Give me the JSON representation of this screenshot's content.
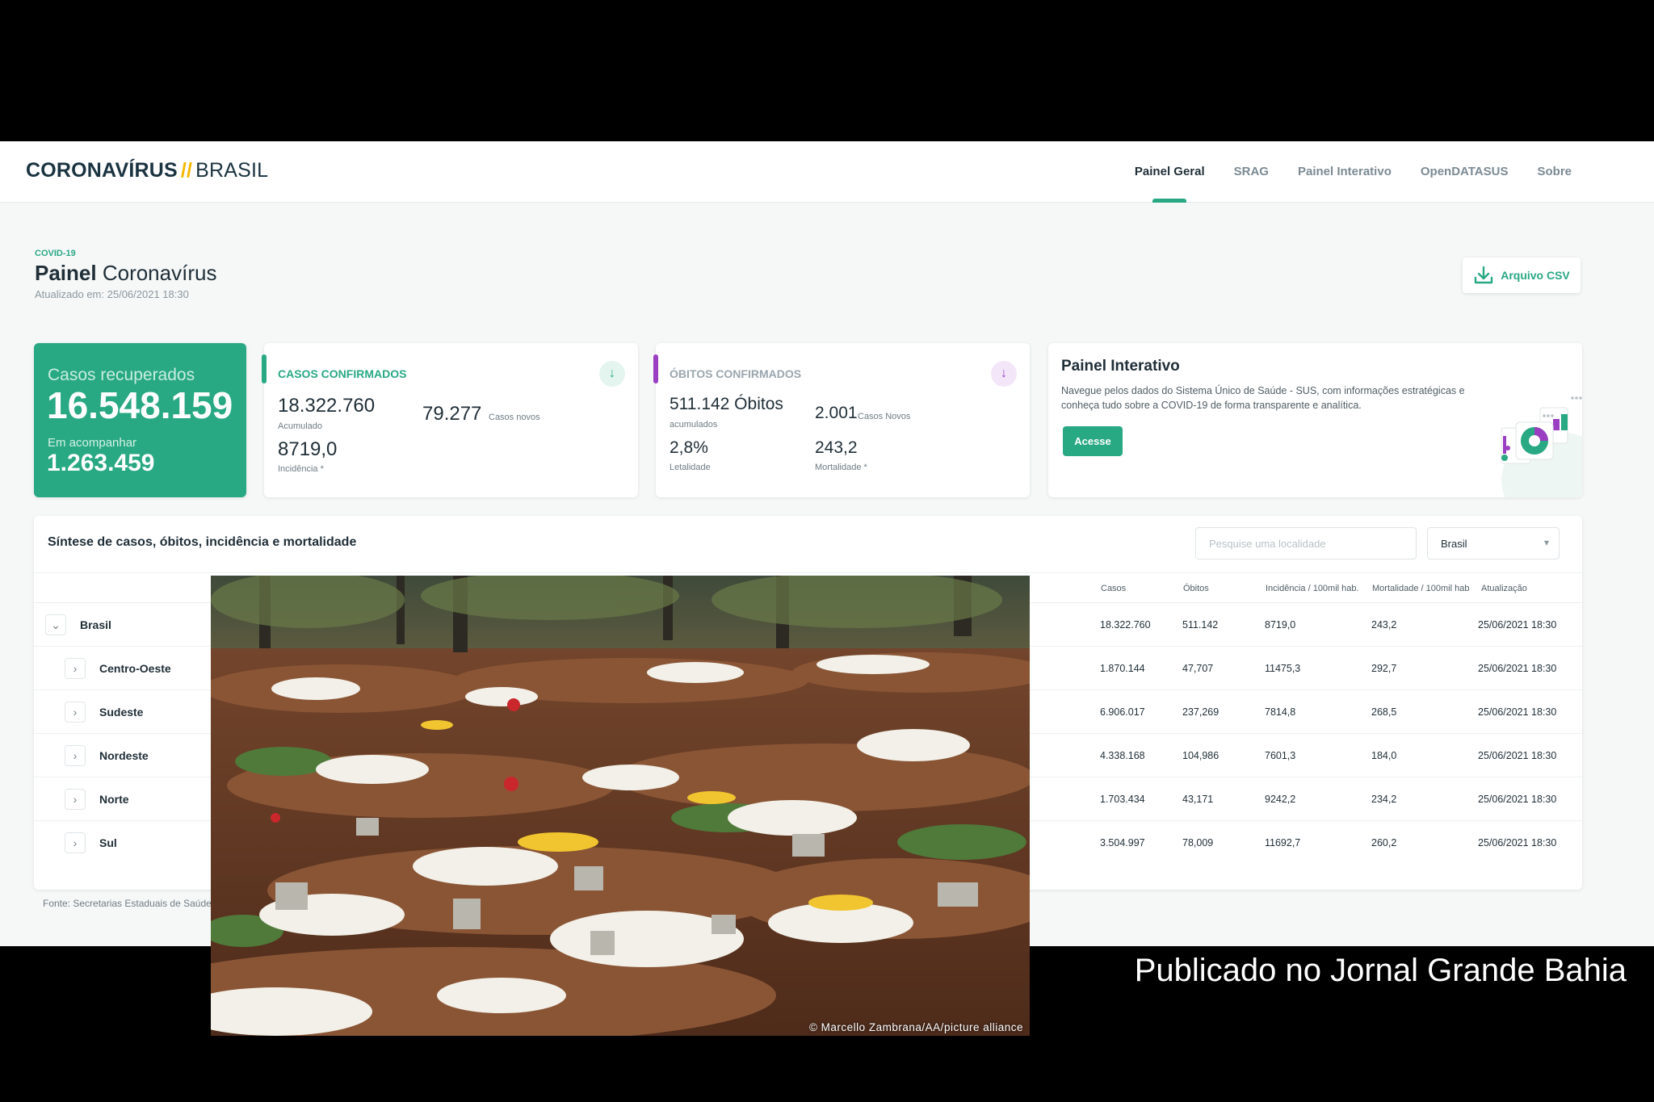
{
  "header": {
    "brand_bold": "CORONAVÍRUS",
    "brand_sep": "//",
    "brand_light": "BRASIL",
    "nav": [
      "Painel Geral",
      "SRAG",
      "Painel Interativo",
      "OpenDATASUS",
      "Sobre"
    ],
    "active_nav": "Painel Geral"
  },
  "title": {
    "tag": "COVID-19",
    "bold": "Painel",
    "light": "Coronavírus",
    "updated_label": "Atualizado em:",
    "updated_value": "25/06/2021 18:30",
    "csv_button": "Arquivo CSV"
  },
  "recovered": {
    "label": "Casos recuperados",
    "value": "16.548.159",
    "follow_label": "Em acompanhar",
    "follow_value": "1.263.459"
  },
  "confirmed": {
    "title": "CASOS CONFIRMADOS",
    "accumulated": "18.322.760",
    "accumulated_label": "Acumulado",
    "new": "79.277",
    "new_label": "Casos novos",
    "incidence": "8719,0",
    "incidence_label": "Incidência *"
  },
  "deaths": {
    "title": "ÓBITOS CONFIRMADOS",
    "accumulated": "511.142 Óbitos",
    "accumulated_label": "acumulados",
    "new": "2.001",
    "new_label": "Casos Novos",
    "lethality": "2,8%",
    "lethality_label": "Letalidade",
    "mortality": "243,2",
    "mortality_label": "Mortalidade *"
  },
  "panel": {
    "title": "Painel Interativo",
    "text": "Navegue pelos dados do Sistema Único de Saúde - SUS, com informações estratégicas e conheça tudo sobre a COVID-19 de forma transparente e analítica.",
    "button": "Acesse"
  },
  "table": {
    "title": "Síntese de casos, óbitos, incidência e mortalidade",
    "search_placeholder": "Pesquise uma localidade",
    "select_value": "Brasil",
    "headers": [
      "Casos",
      "Óbitos",
      "Incidência / 100mil hab.",
      "Mortalidade / 100mil hab",
      "Atualização"
    ],
    "rows": [
      {
        "name": "Brasil",
        "casos": "18.322.760",
        "obitos": "511.142",
        "incidencia": "8719,0",
        "mortalidade": "243,2",
        "atualizacao": "25/06/2021 18:30"
      },
      {
        "name": "Centro-Oeste",
        "casos": "1.870.144",
        "obitos": "47,707",
        "incidencia": "11475,3",
        "mortalidade": "292,7",
        "atualizacao": "25/06/2021 18:30"
      },
      {
        "name": "Sudeste",
        "casos": "6.906.017",
        "obitos": "237,269",
        "incidencia": "7814,8",
        "mortalidade": "268,5",
        "atualizacao": "25/06/2021 18:30"
      },
      {
        "name": "Nordeste",
        "casos": "4.338.168",
        "obitos": "104,986",
        "incidencia": "7601,3",
        "mortalidade": "184,0",
        "atualizacao": "25/06/2021 18:30"
      },
      {
        "name": "Norte",
        "casos": "1.703.434",
        "obitos": "43,171",
        "incidencia": "9242,2",
        "mortalidade": "234,2",
        "atualizacao": "25/06/2021 18:30"
      },
      {
        "name": "Sul",
        "casos": "3.504.997",
        "obitos": "78,009",
        "incidencia": "11692,7",
        "mortalidade": "260,2",
        "atualizacao": "25/06/2021 18:30"
      }
    ],
    "source": "Fonte: Secretarias Estaduais de Saúde"
  },
  "photo": {
    "credit": "© Marcello Zambrana/AA/picture alliance"
  },
  "caption": "Publicado no Jornal Grande Bahia",
  "colors": {
    "accent": "#28a883",
    "deaths_accent": "#9b3fc2",
    "brand_sep": "#f5b800"
  }
}
